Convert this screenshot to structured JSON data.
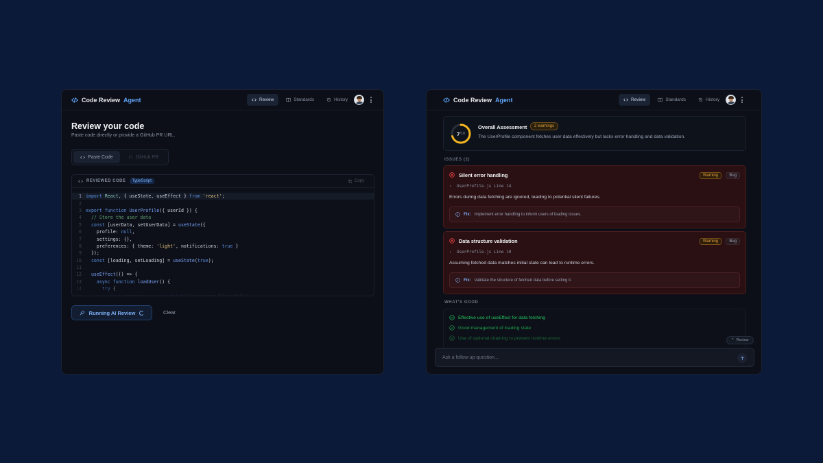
{
  "left": {
    "brand": {
      "name": "Code Review",
      "accent": "Agent"
    },
    "nav": [
      {
        "label": "Review",
        "icon": "code-icon",
        "active": true
      },
      {
        "label": "Standards",
        "icon": "book-icon",
        "active": false
      },
      {
        "label": "History",
        "icon": "history-icon",
        "active": false
      }
    ],
    "title": "Review your code",
    "subtitle": "Paste code directly or provide a GitHub PR URL.",
    "tabs": [
      {
        "label": "Paste Code",
        "icon": "code-icon",
        "active": true
      },
      {
        "label": "GitHub PR",
        "icon": "git-pull-request-icon",
        "active": false
      }
    ],
    "code_header": {
      "label": "REVIEWED CODE",
      "language": "TypeScript",
      "copy": "Copy"
    },
    "code_lines": [
      "import React, { useState, useEffect } from 'react';",
      "",
      "export function UserProfile({ userId }) {",
      "  // Store the user data",
      "  const [userData, setUserData] = useState({",
      "    profile: null,",
      "    settings: {},",
      "    preferences: { theme: 'light', notifications: true }",
      "  });",
      "  const [loading, setLoading] = useState(true);",
      "",
      "  useEffect(() => {",
      "    async function loadUser() {",
      "      try {",
      "        const response = await fetch(`/api/users/${userId}`);"
    ],
    "run_button": "Running AI Review",
    "clear_button": "Clear"
  },
  "right": {
    "brand": {
      "name": "Code Review",
      "accent": "Agent"
    },
    "nav": [
      {
        "label": "Review",
        "icon": "code-icon",
        "active": true
      },
      {
        "label": "Standards",
        "icon": "book-icon",
        "active": false
      },
      {
        "label": "History",
        "icon": "history-icon",
        "active": false
      }
    ],
    "assessment": {
      "score": "7",
      "score_max": "/10",
      "score_value": 0.7,
      "title": "Overall Assessment",
      "warnings_badge": "2 warnings",
      "description": "The UserProfile component fetches user data effectively but lacks error handling and data validation."
    },
    "issues_label": "ISSUES (2)",
    "issues": [
      {
        "title": "Silent error handling",
        "severity": "Warning",
        "category": "Bug",
        "location": "UserProfile.js Line 14",
        "description": "Errors during data fetching are ignored, leading to potential silent failures.",
        "fix_label": "Fix:",
        "fix": "Implement error handling to inform users of loading issues."
      },
      {
        "title": "Data structure validation",
        "severity": "Warning",
        "category": "Bug",
        "location": "UserProfile.js Line 10",
        "description": "Assuming fetched data matches initial state can lead to runtime errors.",
        "fix_label": "Fix:",
        "fix": "Validate the structure of fetched data before setting it."
      }
    ],
    "good_label": "WHAT'S GOOD",
    "good_items": [
      "Effective use of useEffect for data fetching",
      "Good management of loading state",
      "Use of optional chaining to prevent runtime errors"
    ],
    "review_chip": "Review",
    "followup_placeholder": "Ask a follow-up question..."
  },
  "colors": {
    "background": "#0b1a38",
    "accent": "#60a5fa",
    "warning": "#e7a23d",
    "error": "#ef4444",
    "success": "#22c55e"
  }
}
